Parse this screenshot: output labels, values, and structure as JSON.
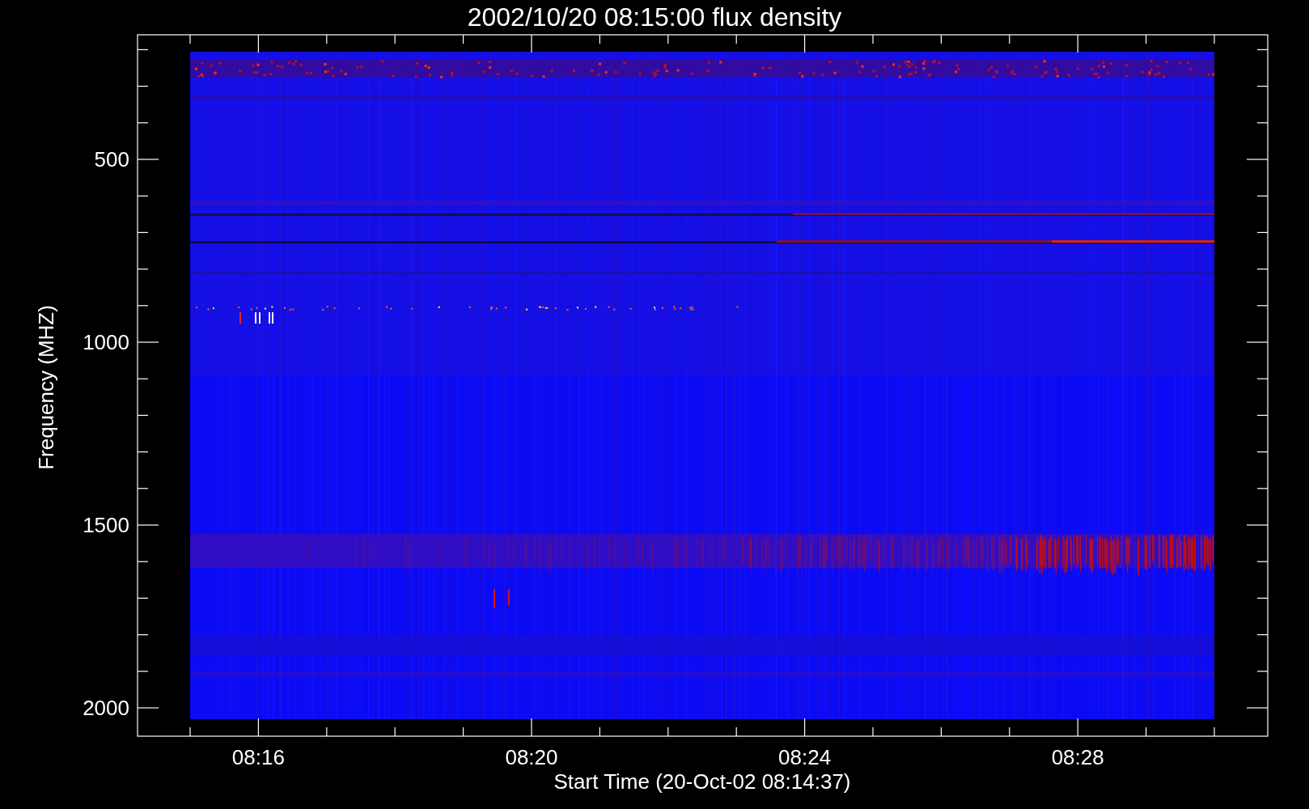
{
  "title": "2002/10/20 08:15:00 flux density",
  "y_axis": {
    "title": "Frequency (MHZ)",
    "tick_labels": [
      "500",
      "1000",
      "1500",
      "2000"
    ]
  },
  "x_axis": {
    "title": "Start Time (20-Oct-02 08:14:37)",
    "tick_labels": [
      "08:16",
      "08:20",
      "08:24",
      "08:28"
    ]
  }
}
